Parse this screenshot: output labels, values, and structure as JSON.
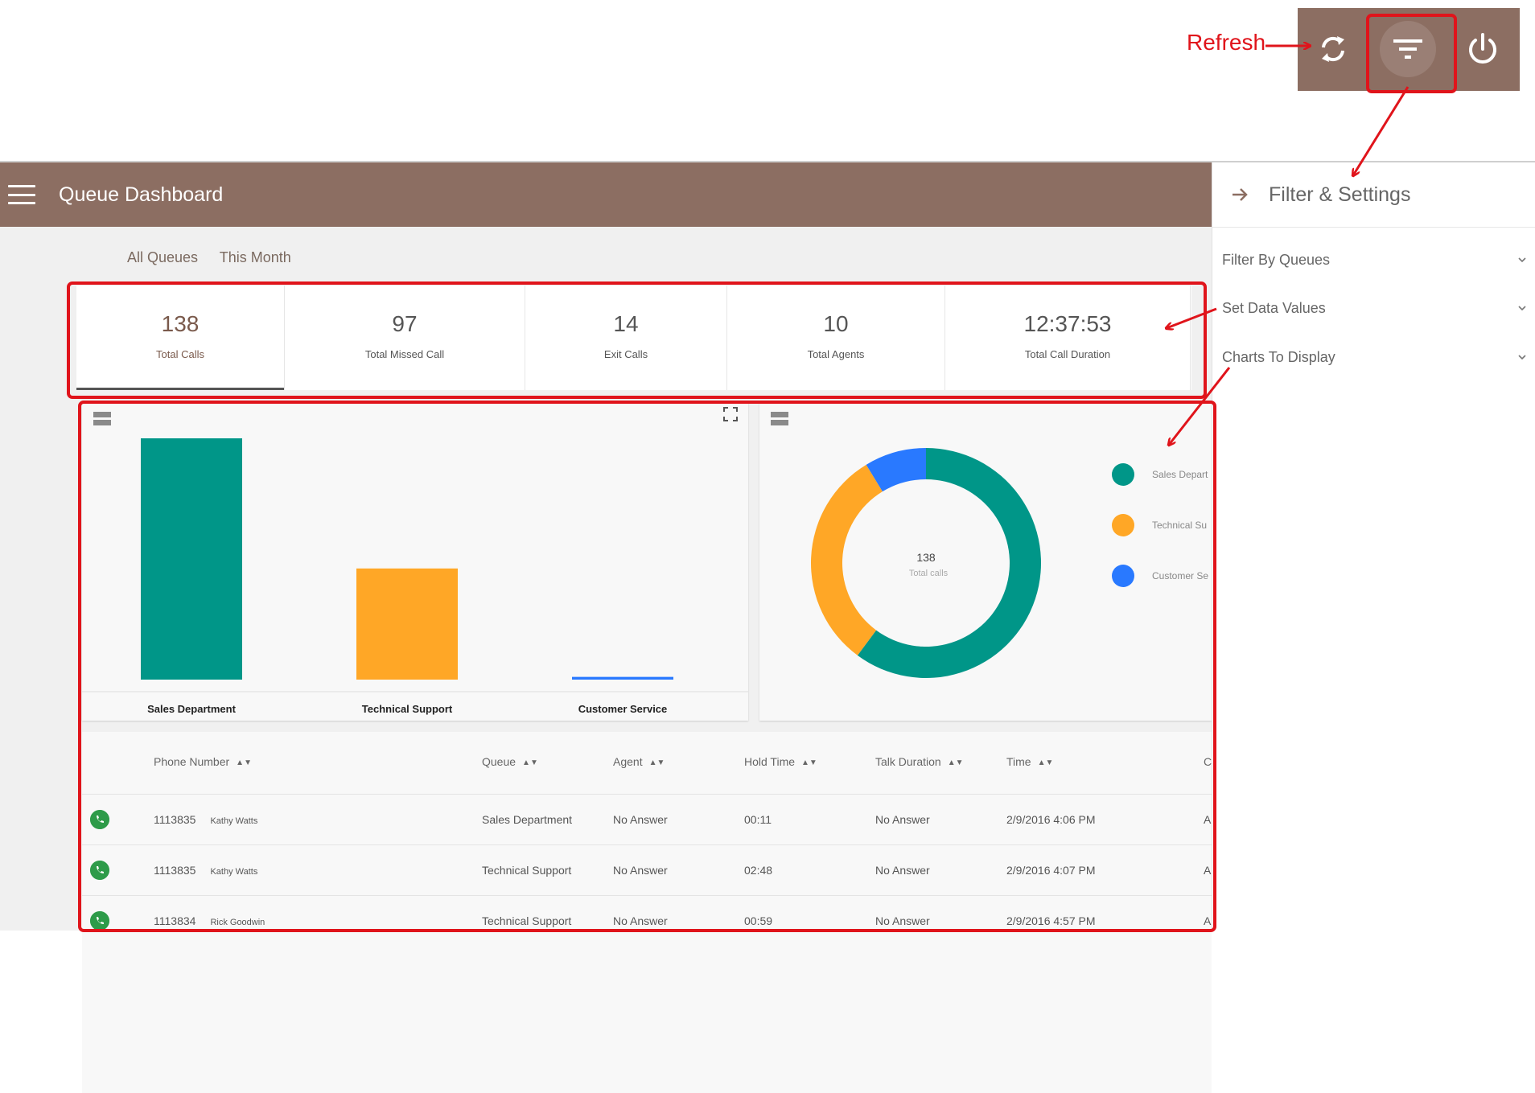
{
  "annotation": {
    "refresh_label": "Refresh"
  },
  "toolbar": {
    "refresh": "refresh-icon",
    "filter": "filter-icon",
    "power": "power-icon"
  },
  "app": {
    "title": "Queue Dashboard",
    "bar_color": "#8c6e62"
  },
  "breadcrumbs": [
    "All Queues",
    "This Month"
  ],
  "stats": [
    {
      "value": "138",
      "label": "Total Calls",
      "active": true
    },
    {
      "value": "97",
      "label": "Total Missed Call"
    },
    {
      "value": "14",
      "label": "Exit Calls"
    },
    {
      "value": "10",
      "label": "Total Agents"
    },
    {
      "value": "12:37:53",
      "label": "Total Call Duration"
    }
  ],
  "chart_data": [
    {
      "type": "bar",
      "categories": [
        "Sales Department",
        "Technical Support",
        "Customer Service"
      ],
      "values": [
        89,
        41,
        1
      ],
      "colors": [
        "#009688",
        "#ffa726",
        "#2979ff"
      ],
      "ylim": [
        0,
        89
      ]
    },
    {
      "type": "pie",
      "labels": [
        "Sales Department",
        "Technical Support",
        "Customer Service"
      ],
      "legend_text": [
        "Sales Depart",
        "Technical Su",
        "Customer Se"
      ],
      "values": [
        83,
        43,
        12
      ],
      "colors": [
        "#009688",
        "#ffa726",
        "#2979ff"
      ],
      "center_value": "138",
      "center_label": "Total calls",
      "legend_position": "right"
    }
  ],
  "table": {
    "headers": [
      "Phone Number",
      "Queue",
      "Agent",
      "Hold Time",
      "Talk Duration",
      "Time",
      "C"
    ],
    "rows": [
      {
        "phone": "1113835",
        "name": "Kathy Watts",
        "queue": "Sales Department",
        "agent": "No Answer",
        "hold": "00:11",
        "talk": "No Answer",
        "time": "2/9/2016 4:06 PM",
        "c": "A"
      },
      {
        "phone": "1113835",
        "name": "Kathy Watts",
        "queue": "Technical Support",
        "agent": "No Answer",
        "hold": "02:48",
        "talk": "No Answer",
        "time": "2/9/2016 4:07 PM",
        "c": "A"
      },
      {
        "phone": "1113834",
        "name": "Rick Goodwin",
        "queue": "Technical Support",
        "agent": "No Answer",
        "hold": "00:59",
        "talk": "No Answer",
        "time": "2/9/2016 4:57 PM",
        "c": "A"
      }
    ]
  },
  "panel": {
    "title": "Filter & Settings",
    "sections": [
      "Filter By Queues",
      "Set Data Values",
      "Charts To Display"
    ]
  },
  "colors": {
    "accent": "#8c6e62",
    "annotation": "#e0141b",
    "call_icon": "#2e9b49"
  }
}
